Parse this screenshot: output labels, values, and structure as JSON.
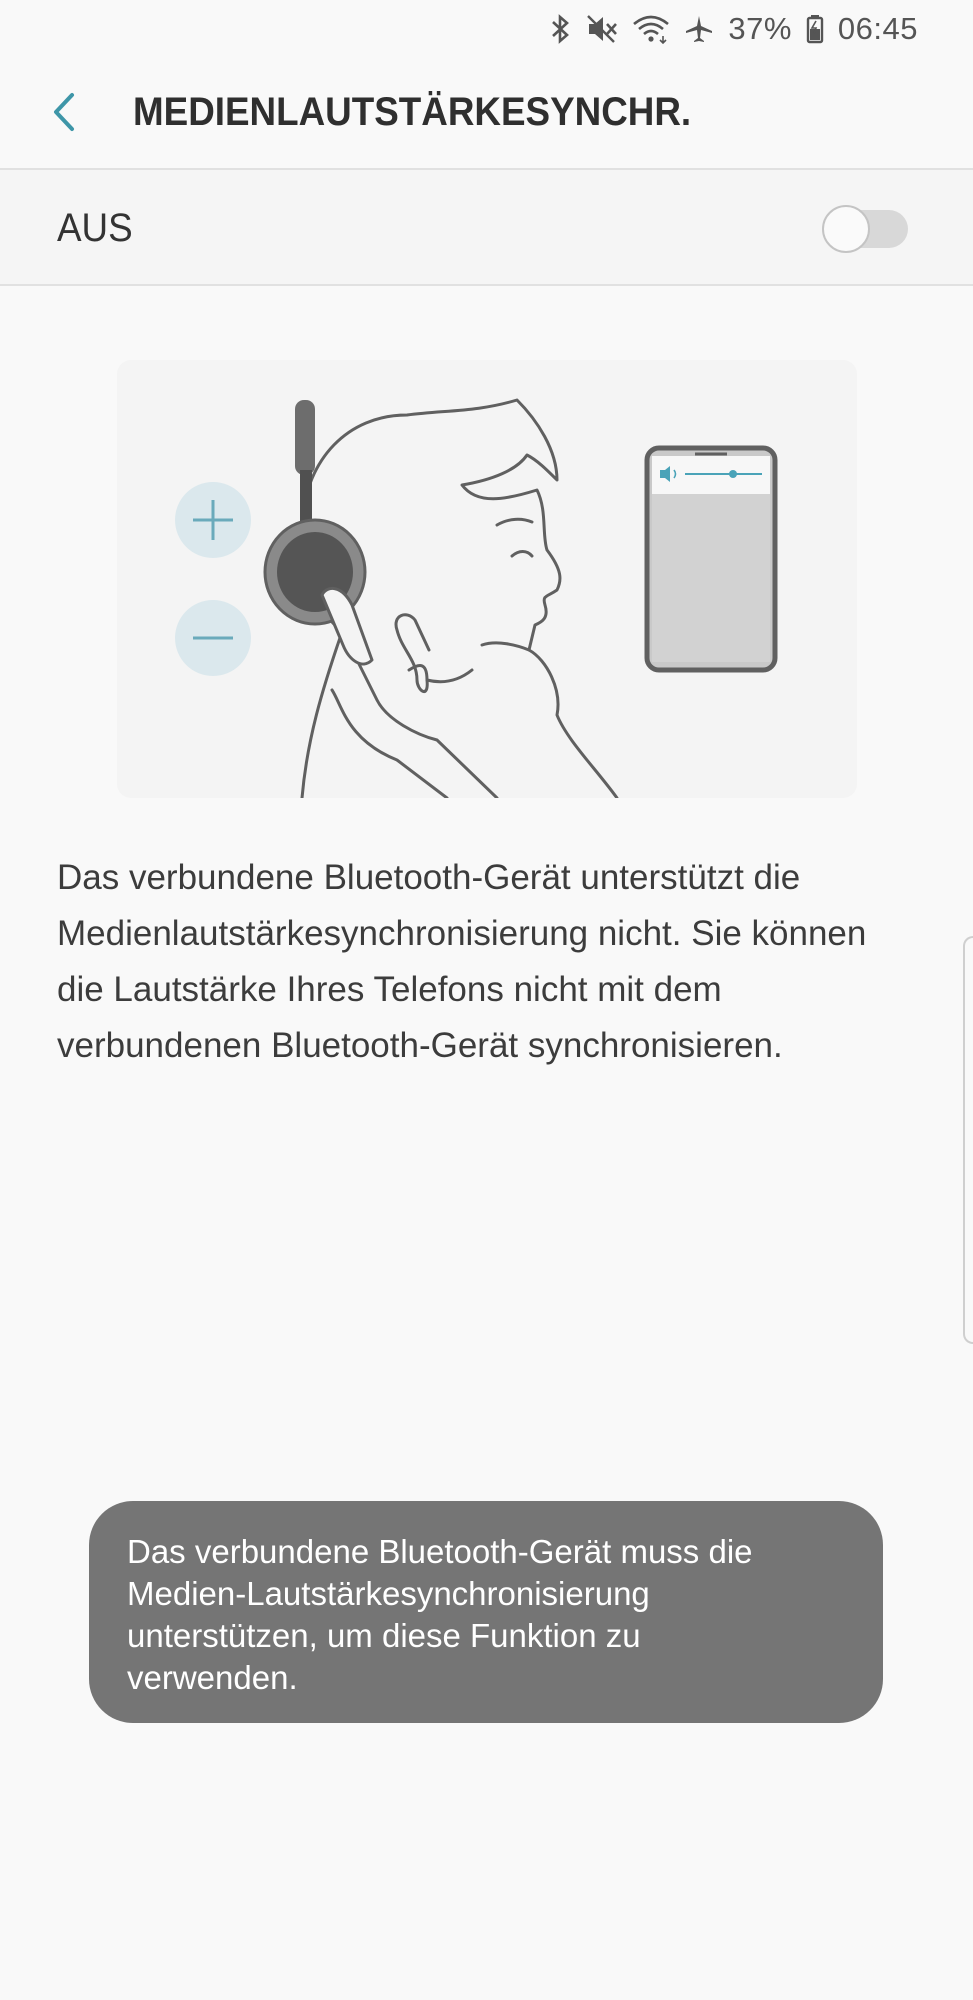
{
  "status_bar": {
    "battery": "37%",
    "time": "06:45",
    "icons": [
      "bluetooth-icon",
      "mute-icon",
      "wifi-icon",
      "airplane-icon",
      "battery-icon"
    ]
  },
  "header": {
    "title": "MEDIENLAUTSTÄRKESYNCHR.",
    "back_icon": "chevron-left-icon"
  },
  "switch": {
    "label": "AUS",
    "state": "off"
  },
  "illustration": {
    "icons": [
      "plus-icon",
      "minus-icon",
      "volume-icon"
    ]
  },
  "description": "Das verbundene Bluetooth-Gerät unterstützt die Medienlautstärkesynchronisierung nicht. Sie können die Lautstärke Ihres Telefons nicht mit dem verbundenen Bluetooth-Gerät synchronisieren.",
  "toast": {
    "text": "Das verbundene Bluetooth-Gerät muss die Medien-Lautstärkesynchronisierung unterstützen, um diese Funktion zu verwenden."
  },
  "colors": {
    "accent": "#3e96a8",
    "background": "#f9f9f9",
    "toast": "#757575"
  }
}
